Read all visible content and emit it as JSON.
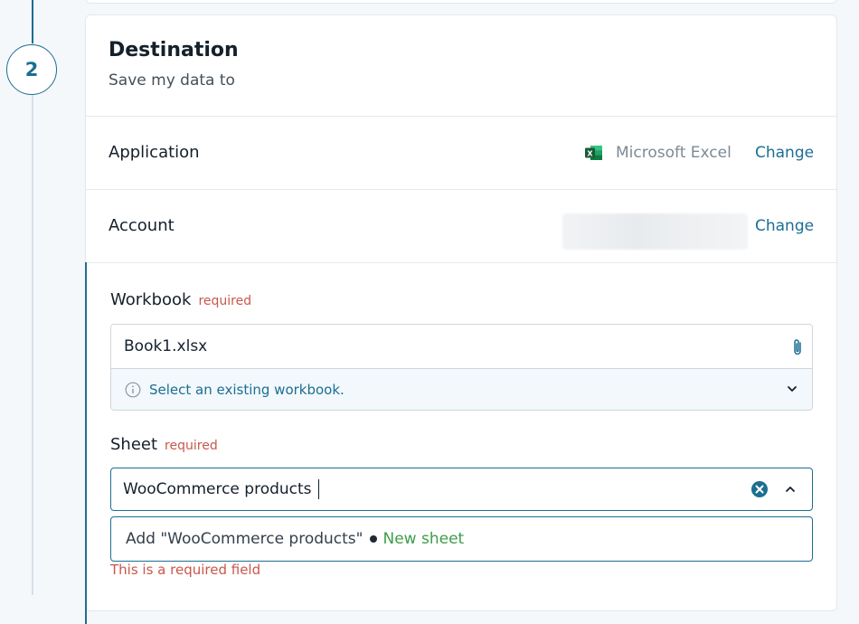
{
  "step": {
    "number": "2"
  },
  "destination": {
    "title": "Destination",
    "subtitle": "Save my data to"
  },
  "application": {
    "label": "Application",
    "icon": "excel-icon",
    "value": "Microsoft Excel",
    "change_label": "Change"
  },
  "account": {
    "label": "Account",
    "change_label": "Change"
  },
  "workbook": {
    "label": "Workbook",
    "required": "required",
    "value": "Book1.xlsx",
    "hint": "Select an existing workbook."
  },
  "sheet": {
    "label": "Sheet",
    "required": "required",
    "value": "WooCommerce products",
    "option_prefix": "Add \"WooCommerce products\"",
    "option_tag": "New sheet",
    "error": "This is a required field"
  },
  "colors": {
    "accent": "#1c6e93",
    "error": "#c0392b",
    "success": "#3f9c4a",
    "excel": "#1d6f42"
  }
}
